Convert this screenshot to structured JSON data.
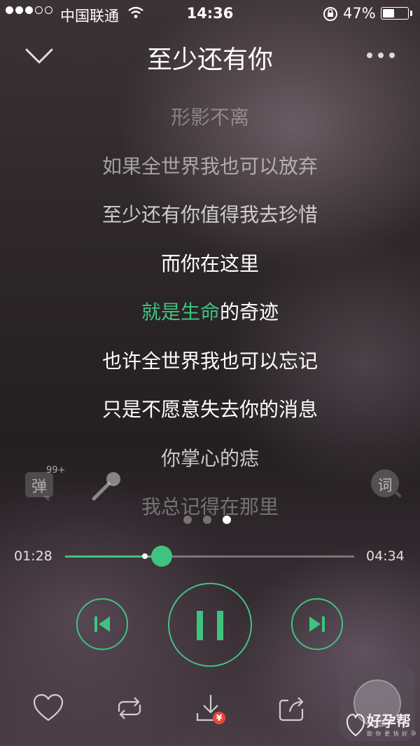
{
  "status_bar": {
    "carrier": "中国联通",
    "time": "14:36",
    "battery_pct": "47%",
    "battery_level": 0.47,
    "signal_bars_filled": 3,
    "signal_bars_total": 5
  },
  "header": {
    "title": "至少还有你",
    "back_icon": "chevron-down-icon",
    "more_icon": "more-dots-icon"
  },
  "lyrics": {
    "lines": [
      "形影不离",
      "如果全世界我也可以放弃",
      "至少还有你值得我去珍惜",
      "而你在这里",
      "就是生命的奇迹",
      "也许全世界我也可以忘记",
      "只是不愿意失去你的消息",
      "你掌心的痣",
      "我总记得在那里"
    ],
    "current_sung": "就是生命",
    "current_rest": "的奇迹"
  },
  "tools": {
    "danmu_label": "弹",
    "danmu_count": "99+",
    "ci_label": "词"
  },
  "player": {
    "current_time": "01:28",
    "total_time": "04:34",
    "progress": 0.333,
    "buffered": 0.275,
    "page_count": 3,
    "page_active": 2
  },
  "watermark": {
    "brand": "好孕帮",
    "tagline": "助 你 更 快 好 孕"
  },
  "colors": {
    "accent": "#3fc380",
    "badge": "#e8483d"
  }
}
